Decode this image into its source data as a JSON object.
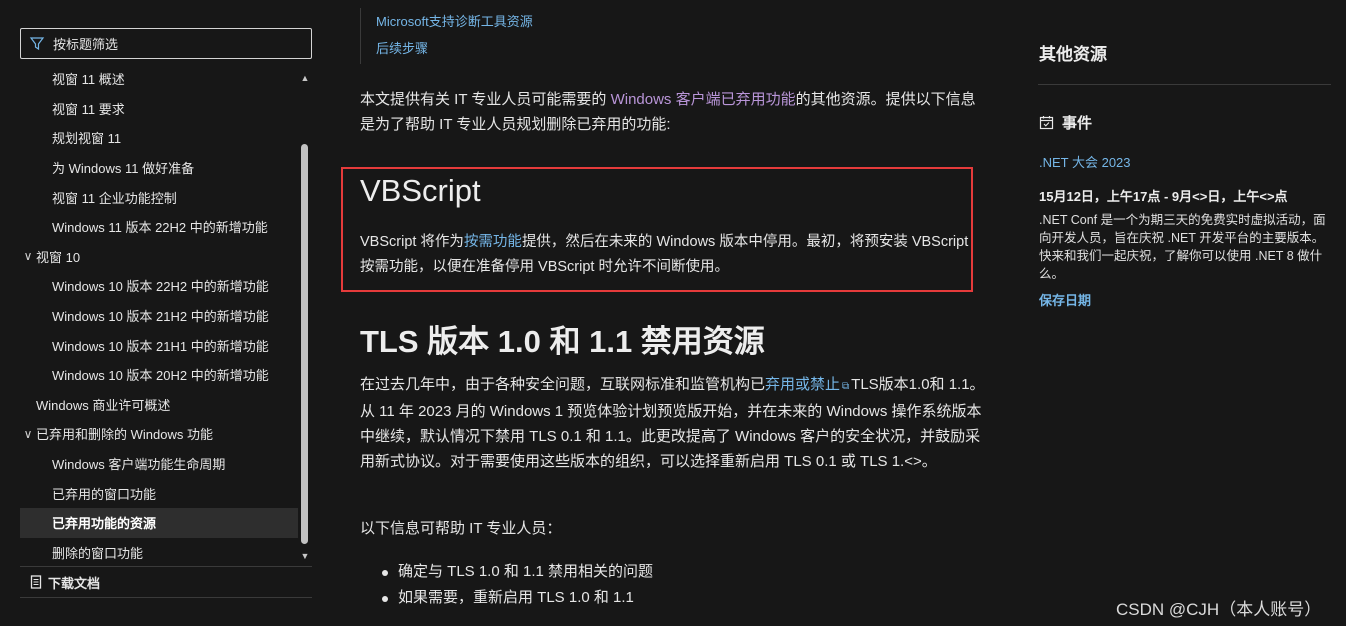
{
  "sidebar": {
    "filter_placeholder": "按标题筛选",
    "toc": [
      {
        "label": "视窗 11 概述",
        "level": 1
      },
      {
        "label": "视窗 11 要求",
        "level": 1
      },
      {
        "label": "规划视窗 11",
        "level": 1
      },
      {
        "label": "为 Windows 11 做好准备",
        "level": 1
      },
      {
        "label": "视窗 11 企业功能控制",
        "level": 1
      },
      {
        "label": "Windows 11 版本 22H2 中的新增功能",
        "level": 1
      },
      {
        "label": "视窗 10",
        "level": 0,
        "expanded": true
      },
      {
        "label": "Windows 10 版本 22H2 中的新增功能",
        "level": 1
      },
      {
        "label": "Windows 10 版本 21H2 中的新增功能",
        "level": 1
      },
      {
        "label": "Windows 10 版本 21H1 中的新增功能",
        "level": 1
      },
      {
        "label": "Windows 10 版本 20H2 中的新增功能",
        "level": 1
      },
      {
        "label": "Windows 商业许可概述",
        "level": 0
      },
      {
        "label": "已弃用和删除的 Windows 功能",
        "level": 0,
        "expanded": true
      },
      {
        "label": "Windows 客户端功能生命周期",
        "level": 1
      },
      {
        "label": "已弃用的窗口功能",
        "level": 1
      },
      {
        "label": "已弃用功能的资源",
        "level": 1,
        "active": true
      },
      {
        "label": "删除的窗口功能",
        "level": 1
      }
    ],
    "download_label": "下载文档"
  },
  "main": {
    "top_links": [
      "Microsoft支持诊断工具资源",
      "后续步骤"
    ],
    "intro": {
      "before": "本文提供有关 IT 专业人员可能需要的 ",
      "link": "Windows 客户端已弃用功能",
      "after": "的其他资源。提供以下信息是为了帮助 IT 专业人员规划删除已弃用的功能:"
    },
    "vbscript": {
      "title": "VBScript",
      "before": "VBScript 将作为",
      "link": "按需功能",
      "after": "提供，然后在未来的 Windows 版本中停用。最初，将预安装 VBScript 按需功能，以便在准备停用 VBScript 时允许不间断使用。"
    },
    "tls": {
      "title": "TLS 版本 1.0 和 1.1 禁用资源",
      "before": "在过去几年中，由于各种安全问题，互联网标准和监管机构已",
      "link": "弃用或禁止",
      "after": "TLS版本1.0和 1.1。从 11 年 2023 月的 Windows 1 预览体验计划预览版开始，并在未来的 Windows 操作系统版本中继续，默认情况下禁用 TLS 0.1 和 1.1。此更改提高了 Windows 客户的安全状况，并鼓励采用新式协议。对于需要使用这些版本的组织，可以选择重新启用 TLS 0.1 或 TLS 1.<>。",
      "help_text": "以下信息可帮助 IT 专业人员：",
      "bullets": [
        "确定与 TLS 1.0 和 1.1 禁用相关的问题",
        "如果需要，重新启用 TLS 1.0 和 1.1"
      ]
    }
  },
  "right": {
    "title": "其他资源",
    "events_label": "事件",
    "event_link": ".NET 大会 2023",
    "event_date": "15月12日，上午17点 - 9月<>日，上午<>点",
    "event_desc": ".NET Conf 是一个为期三天的免费实时虚拟活动，面向开发人员，旨在庆祝 .NET 开发平台的主要版本。快来和我们一起庆祝，了解你可以使用 .NET 8 做什么。",
    "save_date": "保存日期"
  },
  "watermark": "CSDN @CJH（本人账号）",
  "colors": {
    "background": "#171717",
    "link_blue": "#75b6e7",
    "link_purple": "#b995d8",
    "highlight_border": "#e53b3b"
  }
}
